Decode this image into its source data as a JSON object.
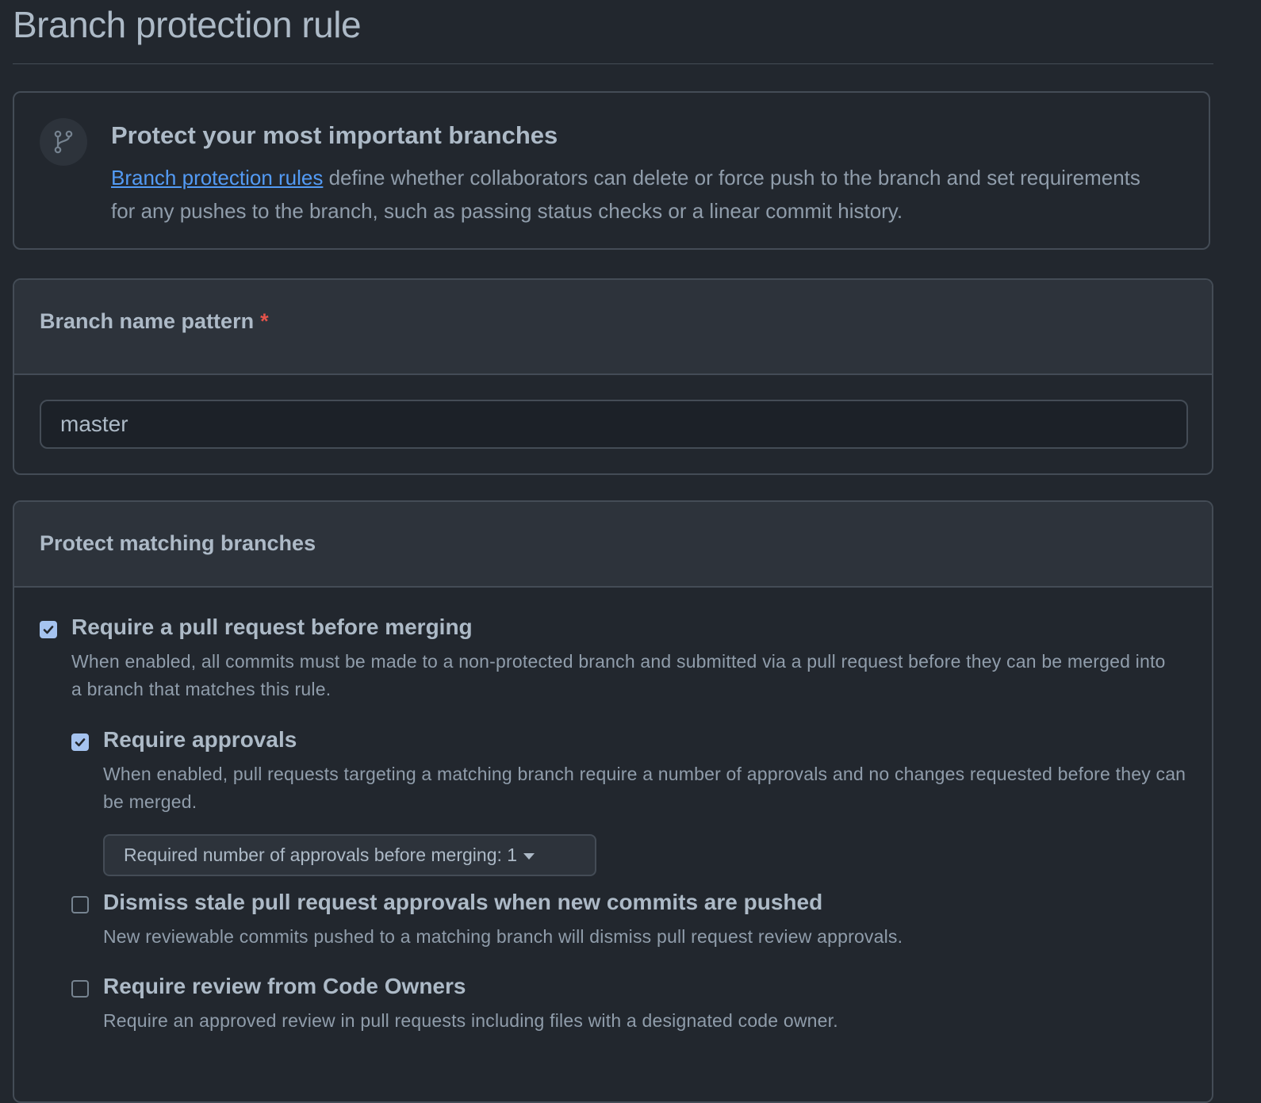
{
  "page": {
    "title": "Branch protection rule"
  },
  "intro": {
    "icon": "git-branch-icon",
    "title": "Protect your most important branches",
    "link_text": "Branch protection rules",
    "text": " define whether collaborators can delete or force push to the branch and set requirements for any pushes to the branch, such as passing status checks or a linear commit history."
  },
  "pattern": {
    "label": "Branch name pattern",
    "required_marker": "*",
    "value": "master"
  },
  "rules": {
    "header": "Protect matching branches",
    "items": [
      {
        "label": "Require a pull request before merging",
        "checked": true,
        "description": "When enabled, all commits must be made to a non-protected branch and submitted via a pull request before they can be merged into a branch that matches this rule."
      },
      {
        "label": "Require approvals",
        "checked": true,
        "description": "When enabled, pull requests targeting a matching branch require a number of approvals and no changes requested before they can be merged.",
        "select_label": "Required number of approvals before merging: 1"
      },
      {
        "label": "Dismiss stale pull request approvals when new commits are pushed",
        "checked": false,
        "description": "New reviewable commits pushed to a matching branch will dismiss pull request review approvals."
      },
      {
        "label": "Require review from Code Owners",
        "checked": false,
        "description": "Require an approved review in pull requests including files with a designated code owner."
      }
    ]
  },
  "colors": {
    "background": "#22272e",
    "panel_header": "#2d333b",
    "border": "#444c56",
    "link": "#539bf5",
    "required": "#e5534b",
    "checkbox_checked": "#a5c3f0"
  }
}
